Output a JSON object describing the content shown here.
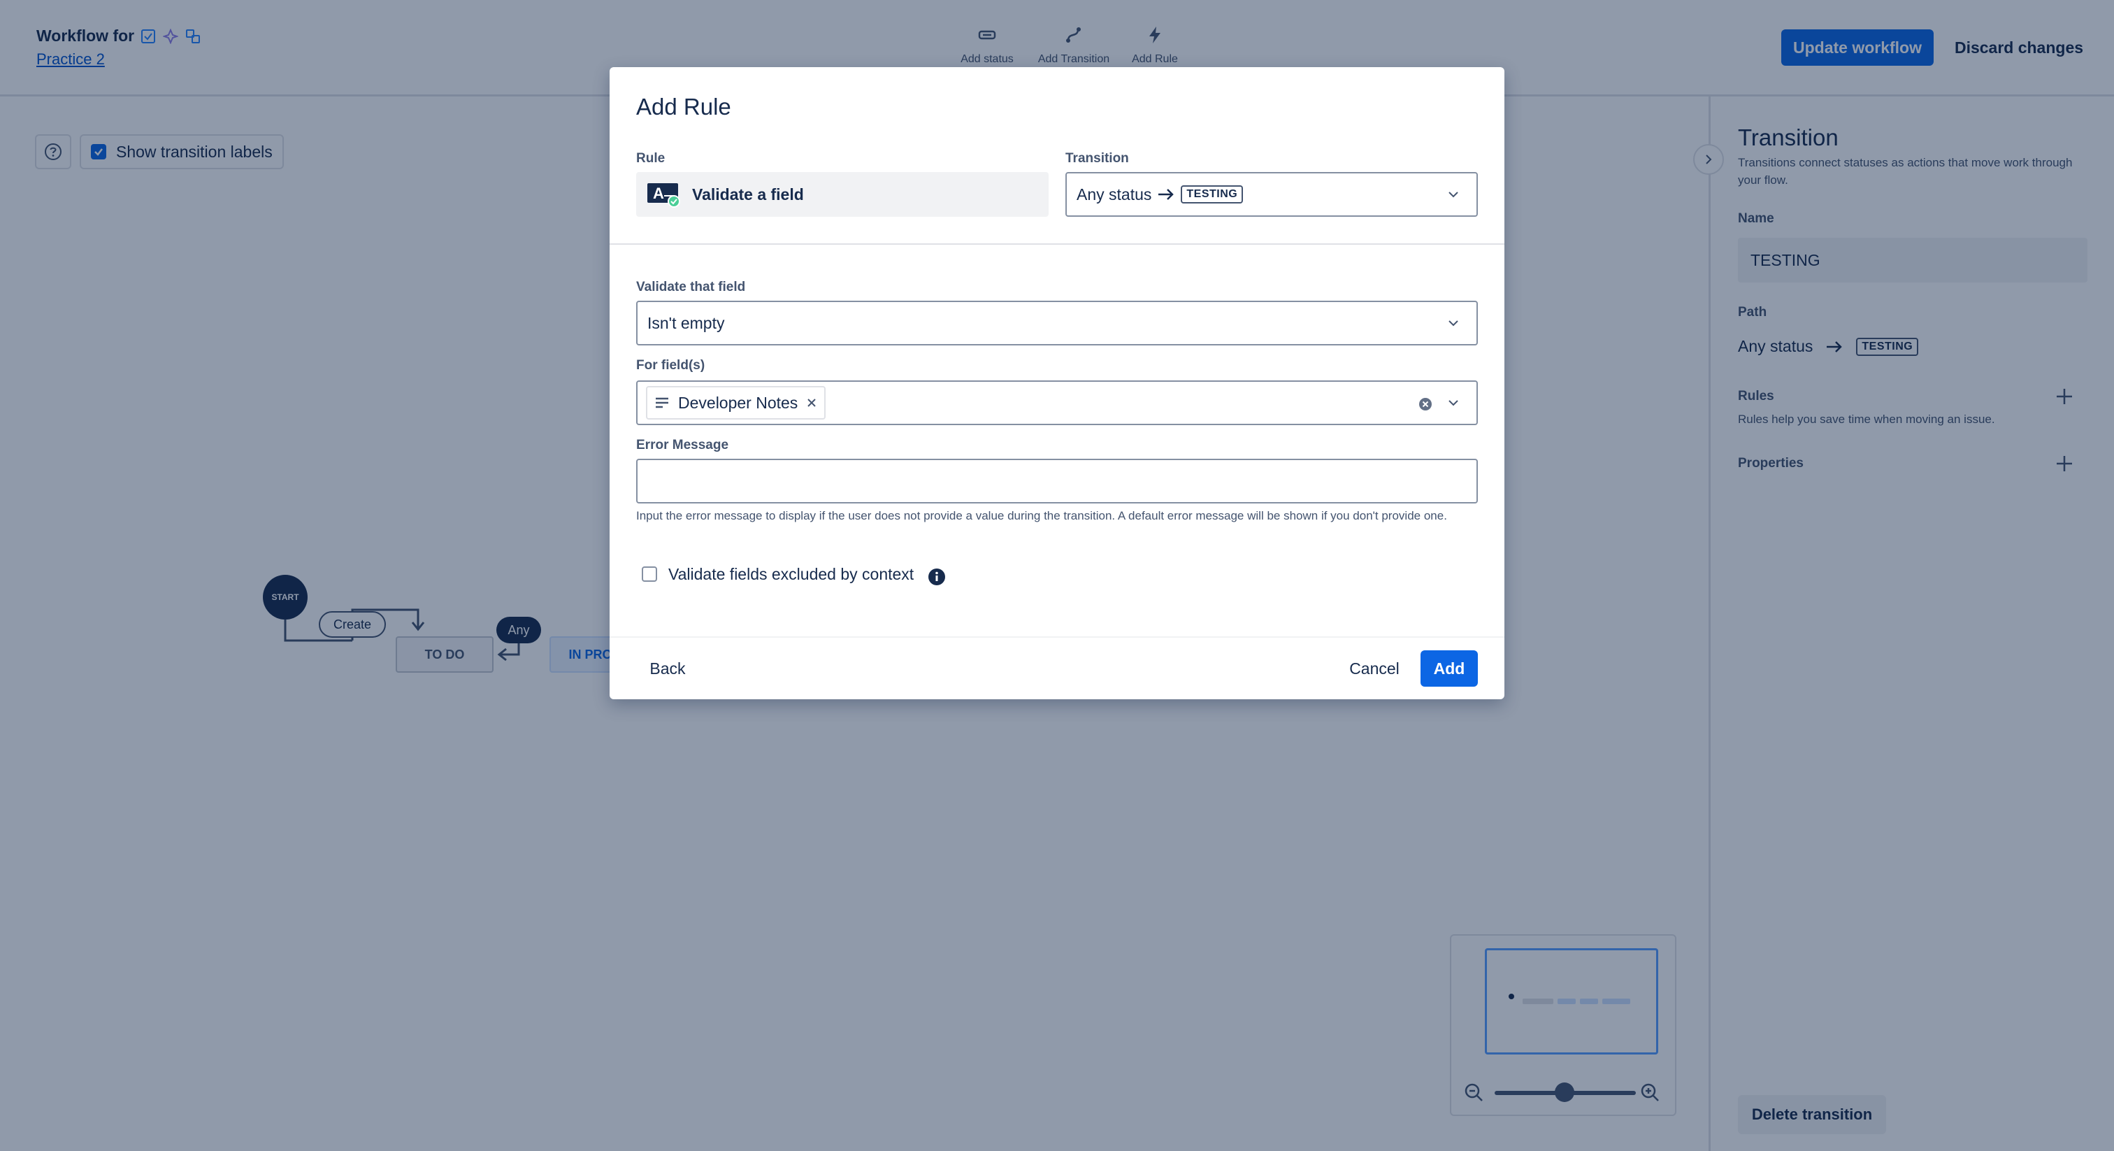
{
  "header": {
    "title": "Workflow for",
    "project_link": "Practice 2",
    "tools": [
      {
        "label": "Add status",
        "icon": "status-icon"
      },
      {
        "label": "Add Transition",
        "icon": "transition-icon"
      },
      {
        "label": "Add Rule",
        "icon": "lightning-icon"
      }
    ],
    "update_button": "Update workflow",
    "discard_button": "Discard changes"
  },
  "canvas": {
    "show_labels": "Show transition labels",
    "nodes": {
      "start": "START",
      "create": "Create",
      "any": "Any",
      "todo": "TO DO",
      "inprogress": "IN PROGRESS"
    }
  },
  "panel": {
    "title": "Transition",
    "description": "Transitions connect statuses as actions that move work through your flow.",
    "name_label": "Name",
    "name_value": "TESTING",
    "path_label": "Path",
    "path_from": "Any status",
    "path_to": "TESTING",
    "rules_label": "Rules",
    "rules_desc": "Rules help you save time when moving an issue.",
    "properties_label": "Properties",
    "delete_button": "Delete transition"
  },
  "modal": {
    "title": "Add Rule",
    "rule_label": "Rule",
    "rule_value": "Validate a field",
    "transition_label": "Transition",
    "transition_from": "Any status",
    "transition_to": "TESTING",
    "validate_label": "Validate that field",
    "validate_value": "Isn't empty",
    "fields_label": "For field(s)",
    "field_chip": "Developer Notes",
    "error_label": "Error Message",
    "error_value": "",
    "helper_text": "Input the error message to display if the user does not provide a value during the transition. A default error message will be shown if you don't provide one.",
    "checkbox_label": "Validate fields excluded by context",
    "back_button": "Back",
    "cancel_button": "Cancel",
    "add_button": "Add"
  },
  "colors": {
    "brand": "#0c66e4",
    "text": "#172b4d",
    "subtle": "#44546f"
  }
}
